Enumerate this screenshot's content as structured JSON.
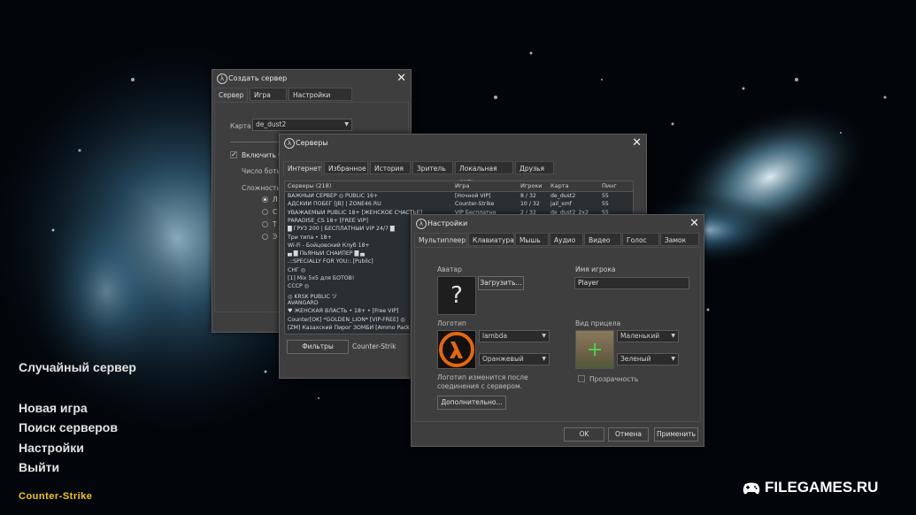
{
  "menu": {
    "random_server": "Случайный сервер",
    "new_game": "Новая игра",
    "find_servers": "Поиск серверов",
    "settings": "Настройки",
    "quit": "Выйти"
  },
  "logo_text": "Counter-Strike",
  "watermark": "FILEGAMES.RU",
  "create_server": {
    "title": "Создать сервер",
    "tabs": [
      "Сервер",
      "Игра",
      "Настройки ботов"
    ],
    "map_label": "Карта",
    "map_value": "de_dust2",
    "enable_bots": "Включить б",
    "bot_count": "Число боты",
    "difficulty": "Сложность",
    "difficulty_options": [
      "Л",
      "С",
      "Т",
      "Э"
    ]
  },
  "servers": {
    "title": "Серверы",
    "tabs": [
      "Интернет",
      "Избранное",
      "История",
      "Зритель",
      "Локальная сеть",
      "Друзья"
    ],
    "columns": [
      "Серверы (218)",
      "Игра",
      "Игроки",
      "Карта",
      "Пинг"
    ],
    "rows": [
      {
        "name": "ВАЖНЫЙ СЕРВЕР ◎ PUBLIC 16+",
        "game": "[Ночной VIP]",
        "players": "8 / 32",
        "map": "de_dust2",
        "ping": "55"
      },
      {
        "name": "АДСКИЙ ПОБЕГ [JB] | ZONE46.RU",
        "game": "Counter-Strike",
        "players": "10 / 32",
        "map": "jail_xmf",
        "ping": "55"
      },
      {
        "name": "УВАЖАЕМЫЙ PUBLIC 18+ [ЖЕНСКОЕ СЧАСТЬЕ]",
        "game": "VIP Бесплатно",
        "players": "2 / 32",
        "map": "de_dust2_2x2",
        "ping": "55"
      },
      {
        "name": "PARADISE_CS 18+ [FREE VIP]",
        "game": "",
        "players": "",
        "map": "",
        "ping": ""
      },
      {
        "name": "█ ГРУЗ 200 | БЕСПЛАТНЫЙ VIP 24/7 █",
        "game": "",
        "players": "",
        "map": "",
        "ping": ""
      },
      {
        "name": "Три типа • 18+",
        "game": "",
        "players": "",
        "map": "",
        "ping": ""
      },
      {
        "name": "Wi-Fi - Бойцовский Клуб 18+",
        "game": "",
        "players": "",
        "map": "",
        "ping": ""
      },
      {
        "name": "▄ █ ПЬЯНЫЙ СНАЙПЕР █ ▄",
        "game": "",
        "players": "",
        "map": "",
        "ping": ""
      },
      {
        "name": ".::SPECIALLY FOR YOU::.[Public]",
        "game": "",
        "players": "",
        "map": "",
        "ping": ""
      },
      {
        "name": "СНГ ◎",
        "game": "",
        "players": "",
        "map": "",
        "ping": ""
      },
      {
        "name": "[1] Mix 5x5 для БОТОВ!",
        "game": "",
        "players": "",
        "map": "",
        "ping": ""
      },
      {
        "name": "СССР ◎",
        "game": "",
        "players": "",
        "map": "",
        "ping": ""
      },
      {
        "name": "◎ KRSK PUBLIC ツ",
        "game": "",
        "players": "",
        "map": "",
        "ping": ""
      },
      {
        "name": "AVANGARD",
        "game": "",
        "players": "",
        "map": "",
        "ping": ""
      },
      {
        "name": "♥ ЖЕНСКАЯ ВЛАСТЬ • 18+ • [Free VIP]",
        "game": "",
        "players": "",
        "map": "",
        "ping": ""
      },
      {
        "name": "Counter[OK] *GOLDEN_LION* [VIP-FREE] ◎",
        "game": "",
        "players": "",
        "map": "",
        "ping": ""
      },
      {
        "name": "[ZM] Казахский Пирог ЗОМБИ [Ammo Pack]",
        "game": "",
        "players": "",
        "map": "",
        "ping": ""
      }
    ],
    "filters_button": "Фильтры",
    "filter_game": "Counter-Strik"
  },
  "settings": {
    "title": "Настройки",
    "tabs": [
      "Мультиплеер",
      "Клавиатура",
      "Мышь",
      "Аудио",
      "Видео",
      "Голос",
      "Замок"
    ],
    "avatar_label": "Аватар",
    "avatar_placeholder": "?",
    "upload_button": "Загрузить...",
    "player_name_label": "Имя игрока",
    "player_name_value": "Player",
    "logo_label": "Логотип",
    "logo_combo": "lambda",
    "logo_color_combo": "Оранжевый",
    "logo_note": "Логотип изменится после соединения с сервером.",
    "crosshair_label": "Вид прицела",
    "crosshair_size": "Маленький",
    "crosshair_color": "Зеленый",
    "transparency_label": "Прозрачность",
    "advanced_button": "Дополнительно...",
    "ok_button": "OK",
    "cancel_button": "Отмена",
    "apply_button": "Применить"
  }
}
